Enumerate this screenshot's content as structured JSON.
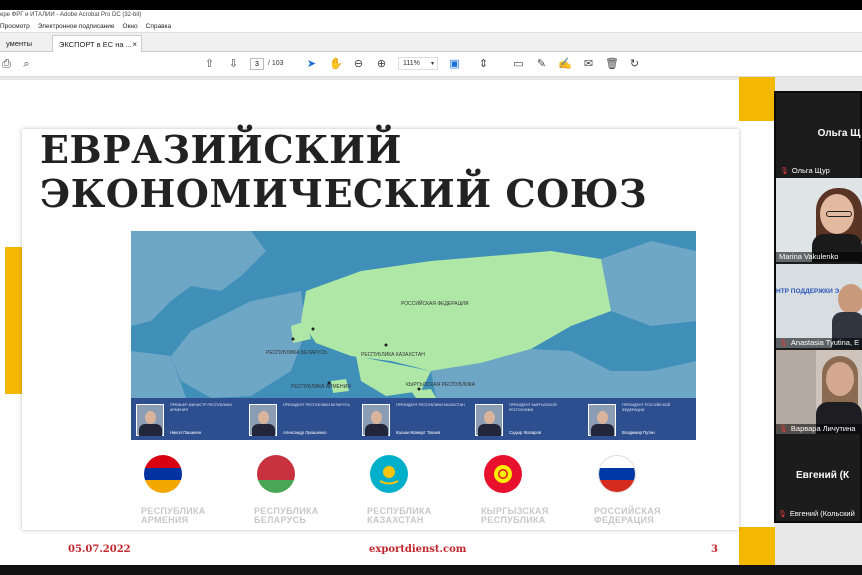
{
  "window": {
    "title": "ере ФРГ и ИТАЛИИ - Adobe Acrobat Pro DC (32-bit)"
  },
  "menu": [
    "Просмотр",
    "Электронное подписание",
    "Окно",
    "Справка"
  ],
  "tabs": {
    "left_label": "ументы",
    "active_label": "ЭКСПОРТ в ЕС на ...",
    "close_glyph": "×"
  },
  "toolbar": {
    "page_current": "3",
    "page_total": "/ 103",
    "zoom": "111%",
    "icons": [
      "print-icon",
      "search-icon",
      "page-up-icon",
      "page-down-icon",
      "select-cursor-icon",
      "hand-icon",
      "zoom-out-icon",
      "zoom-in-icon",
      "fit-page-icon",
      "scroll-mode-icon",
      "comment-icon",
      "pen-icon",
      "sign-icon",
      "stamp-icon",
      "delete-icon",
      "rotate-icon"
    ]
  },
  "slide": {
    "heading_line1": "ЕВРАЗИЙСКИЙ",
    "heading_line2": "ЭКОНОМИЧЕСКИЙ СОЮЗ",
    "map_labels": {
      "russia": "РОССИЙСКАЯ ФЕДЕРАЦИЯ",
      "belarus": "РЕСПУБЛИКА БЕЛАРУСЬ",
      "kazakhstan": "РЕСПУБЛИКА КАЗАХСТАН",
      "armenia": "РЕСПУБЛИКА АРМЕНИЯ",
      "kyrgyzstan": "КЫРГЫЗСКАЯ РЕСПУБЛИКА"
    },
    "presidents": [
      {
        "role": "Премьер-министр Республики Армения",
        "name": "Никол Пашинян"
      },
      {
        "role": "Президент Республики Беларусь",
        "name": "Александр Лукашенко"
      },
      {
        "role": "Президент Республики Казахстан",
        "name": "Касым-Жомарт Токаев"
      },
      {
        "role": "Президент Кыргызской Республики",
        "name": "Садыр Жапаров"
      },
      {
        "role": "Президент Российской Федерации",
        "name": "Владимир Путин"
      }
    ],
    "countries": [
      {
        "line1": "РЕСПУБЛИКА",
        "line2": "АРМЕНИЯ",
        "colors": [
          "#d90012",
          "#0033a0",
          "#f2a800"
        ]
      },
      {
        "line1": "РЕСПУБЛИКА",
        "line2": "БЕЛАРУСЬ",
        "colors": [
          "#c8313e",
          "#c8313e",
          "#4aa657"
        ]
      },
      {
        "line1": "РЕСПУБЛИКА",
        "line2": "КАЗАХСТАН",
        "colors": [
          "#00afca",
          "#00afca",
          "#00afca"
        ]
      },
      {
        "line1": "КЫРГЫЗСКАЯ",
        "line2": "РЕСПУБЛИКА",
        "colors": [
          "#e8112d",
          "#e8112d",
          "#e8112d"
        ]
      },
      {
        "line1": "РОССИЙСКАЯ",
        "line2": "ФЕДЕРАЦИЯ",
        "colors": [
          "#ffffff",
          "#0039a6",
          "#d52b1e"
        ]
      }
    ],
    "footer_date": "05.07.2022",
    "footer_site": "exportdienst.com",
    "footer_page": "3"
  },
  "participants": {
    "top_name": "Ольга Щ",
    "top_label": "Ольга Щур",
    "tiles": [
      {
        "label": "Marina Vakulenko"
      },
      {
        "label": "Anastasia Tyutina, E",
        "banner": "НТР ПОДДЕРЖКИ Э"
      },
      {
        "label": "Варвара Личутина"
      }
    ],
    "bottom_name": "Евгений (К",
    "bottom_label": "Евгений (Кольский"
  }
}
